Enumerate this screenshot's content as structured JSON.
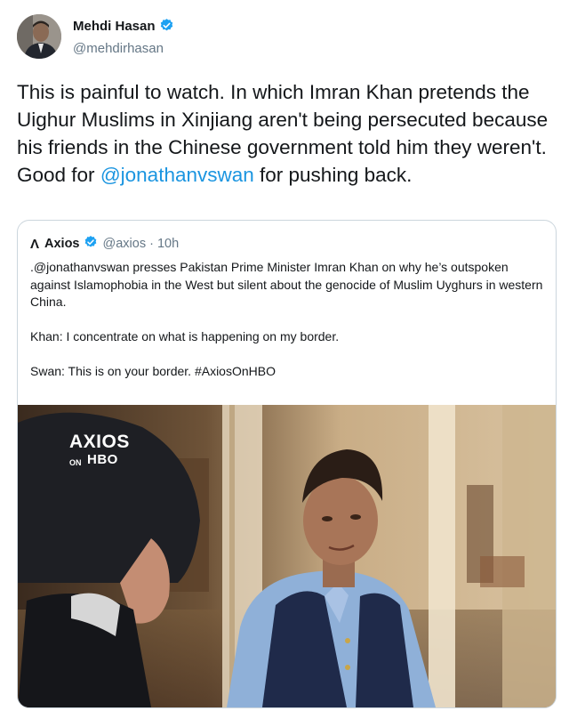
{
  "tweet": {
    "author_name": "Mehdi Hasan",
    "author_handle": "@mehdirhasan",
    "text_before": "This is painful to watch. In which Imran Khan pretends the Uighur Muslims in Xinjiang aren't being persecuted because his friends in the Chinese government told him they weren't. Good for ",
    "mention": "@jonathanvswan",
    "text_after": " for pushing back."
  },
  "quoted": {
    "logo": "Λ",
    "name": "Axios",
    "handle": "@axios",
    "separator": "·",
    "time": "10h",
    "paragraphs": [
      ".@jonathanvswan presses Pakistan Prime Minister Imran Khan on why he’s outspoken against Islamophobia in the West but silent about the genocide of Muslim Uyghurs in western China.",
      "Khan: I concentrate on what is happening on my border.",
      "Swan: This is on your border. #AxiosOnHBO"
    ],
    "media_watermark": {
      "word": "AXIOS",
      "on": "ON",
      "hbo": "HBO"
    }
  },
  "colors": {
    "link": "#1b95e0",
    "verified": "#1da1f2",
    "secondary_text": "#657786",
    "border": "#ccd6dd"
  }
}
